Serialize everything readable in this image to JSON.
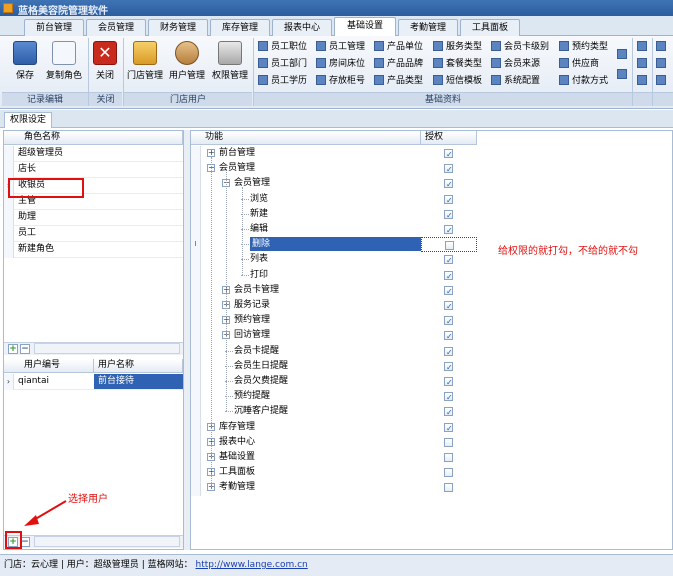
{
  "window": {
    "title": "蓝格美容院管理软件"
  },
  "ribbon_tabs": [
    {
      "label": "前台管理",
      "active": false
    },
    {
      "label": "会员管理",
      "active": false
    },
    {
      "label": "财务管理",
      "active": false
    },
    {
      "label": "库存管理",
      "active": false
    },
    {
      "label": "报表中心",
      "active": false
    },
    {
      "label": "基础设置",
      "active": true
    },
    {
      "label": "考勤管理",
      "active": false
    },
    {
      "label": "工具面板",
      "active": false
    }
  ],
  "ribbon": {
    "record_group": {
      "label": "记录编辑",
      "save": "保存",
      "copy_role": "复制角色"
    },
    "close_group": {
      "label": "关闭",
      "close": "关闭"
    },
    "store_user_group": {
      "label": "门店用户",
      "store_mgmt": "门店管理",
      "user_mgmt": "用户管理",
      "perm_mgmt": "权限管理"
    },
    "basic_data_group": {
      "label": "基础资料",
      "col1": [
        "员工职位",
        "员工部门",
        "员工学历"
      ],
      "col2": [
        "员工管理",
        "房间床位",
        "存放柜号"
      ],
      "col3": [
        "产品单位",
        "产品品牌",
        "产品类型"
      ],
      "col4": [
        "服务类型",
        "套餐类型",
        "短信模板"
      ],
      "col5": [
        "会员卡级别",
        "会员来源",
        "系统配置"
      ],
      "col6": [
        "预约类型",
        "供应商",
        "付款方式"
      ]
    }
  },
  "subtab": {
    "label": "权限设定"
  },
  "roles_grid": {
    "header": "角色名称",
    "rows": [
      "超级管理员",
      "店长",
      "收银员",
      "主管",
      "助理",
      "员工",
      "新建角色"
    ],
    "current_index": 2
  },
  "users_grid": {
    "headers": [
      "用户编号",
      "用户名称"
    ],
    "rows": [
      {
        "id": "qiantai",
        "name": "前台接待"
      }
    ]
  },
  "perm_grid": {
    "headers": [
      "功能",
      "授权"
    ],
    "rows": [
      {
        "label": "前台管理",
        "level": 0,
        "expander": "+",
        "checked": true
      },
      {
        "label": "会员管理",
        "level": 0,
        "expander": "-",
        "checked": true
      },
      {
        "label": "会员管理",
        "level": 1,
        "expander": "-",
        "checked": true
      },
      {
        "label": "浏览",
        "level": 2,
        "expander": "",
        "checked": true
      },
      {
        "label": "新建",
        "level": 2,
        "expander": "",
        "checked": true
      },
      {
        "label": "编辑",
        "level": 2,
        "expander": "",
        "checked": true
      },
      {
        "label": "删除",
        "level": 2,
        "expander": "",
        "checked": false,
        "selected": true
      },
      {
        "label": "列表",
        "level": 2,
        "expander": "",
        "checked": true
      },
      {
        "label": "打印",
        "level": 2,
        "expander": "",
        "checked": true
      },
      {
        "label": "会员卡管理",
        "level": 1,
        "expander": "+",
        "checked": true
      },
      {
        "label": "服务记录",
        "level": 1,
        "expander": "+",
        "checked": true
      },
      {
        "label": "预约管理",
        "level": 1,
        "expander": "+",
        "checked": true
      },
      {
        "label": "回访管理",
        "level": 1,
        "expander": "+",
        "checked": true
      },
      {
        "label": "会员卡提醒",
        "level": 1,
        "expander": "",
        "checked": true
      },
      {
        "label": "会员生日提醒",
        "level": 1,
        "expander": "",
        "checked": true
      },
      {
        "label": "会员欠费提醒",
        "level": 1,
        "expander": "",
        "checked": true
      },
      {
        "label": "预约提醒",
        "level": 1,
        "expander": "",
        "checked": true
      },
      {
        "label": "沉睡客户提醒",
        "level": 1,
        "expander": "",
        "checked": true
      },
      {
        "label": "库存管理",
        "level": 0,
        "expander": "+",
        "checked": true
      },
      {
        "label": "报表中心",
        "level": 0,
        "expander": "+",
        "checked": false
      },
      {
        "label": "基础设置",
        "level": 0,
        "expander": "+",
        "checked": false
      },
      {
        "label": "工具面板",
        "level": 0,
        "expander": "+",
        "checked": false
      },
      {
        "label": "考勤管理",
        "level": 0,
        "expander": "+",
        "checked": false
      }
    ]
  },
  "annotations": {
    "grant_hint": "给权限的就打勾，不给的就不勾",
    "select_user_hint": "选择用户"
  },
  "statusbar": {
    "store": "门店：云心理",
    "user": "用户：超级管理员",
    "site_label": "蓝格网站：",
    "url": "http://www.lange.com.cn"
  },
  "colors": {
    "accent": "#2f62b2",
    "annotation": "#e01010",
    "titlebar": "#2c5d9e"
  }
}
